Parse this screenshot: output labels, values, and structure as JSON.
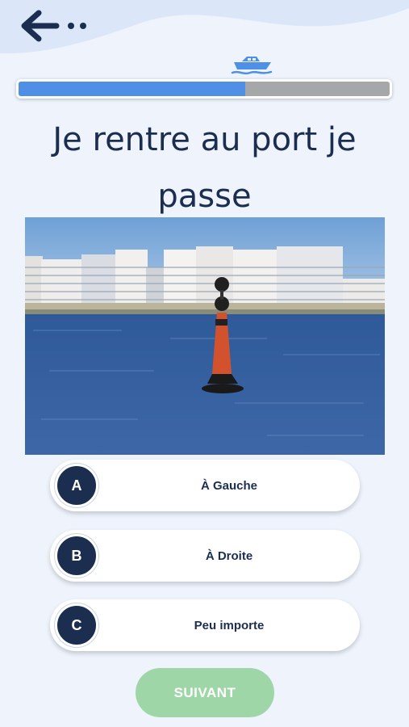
{
  "header": {
    "back_icon": "arrow-left-icon",
    "progress_percent": 61,
    "progress_color": "#4f8fe6",
    "boat_icon": "speedboat-icon"
  },
  "question": {
    "text": "Je rentre au port je passe"
  },
  "image": {
    "subject": "buoy-photo"
  },
  "answers": [
    {
      "letter": "A",
      "label": "À Gauche"
    },
    {
      "letter": "B",
      "label": "À Droite"
    },
    {
      "letter": "C",
      "label": "Peu importe"
    }
  ],
  "next_button": {
    "label": "SUIVANT",
    "color": "#9fd6a8"
  },
  "colors": {
    "primary": "#1c2e4f",
    "background": "#eef3fc"
  }
}
